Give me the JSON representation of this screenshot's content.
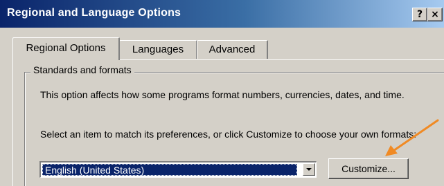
{
  "window": {
    "title": "Regional and Language Options",
    "help_glyph": "?",
    "close_glyph": "×"
  },
  "tabs": [
    {
      "label": "Regional Options",
      "active": true
    },
    {
      "label": "Languages",
      "active": false
    },
    {
      "label": "Advanced",
      "active": false
    }
  ],
  "standards": {
    "group_label": "Standards and formats",
    "description": "This option affects how some programs format numbers, currencies, dates, and time.",
    "prompt": "Select an item to match its preferences, or click Customize to choose your own formats:",
    "selected_locale": "English (United States)",
    "customize_label": "Customize..."
  },
  "colors": {
    "annotation_arrow": "#f08a24",
    "title_bar_start": "#0a246a",
    "title_bar_end": "#a6caf0",
    "selection": "#0a246a"
  },
  "icons": {
    "dropdown": "chevron-down-icon",
    "annotation": "arrow-icon"
  }
}
